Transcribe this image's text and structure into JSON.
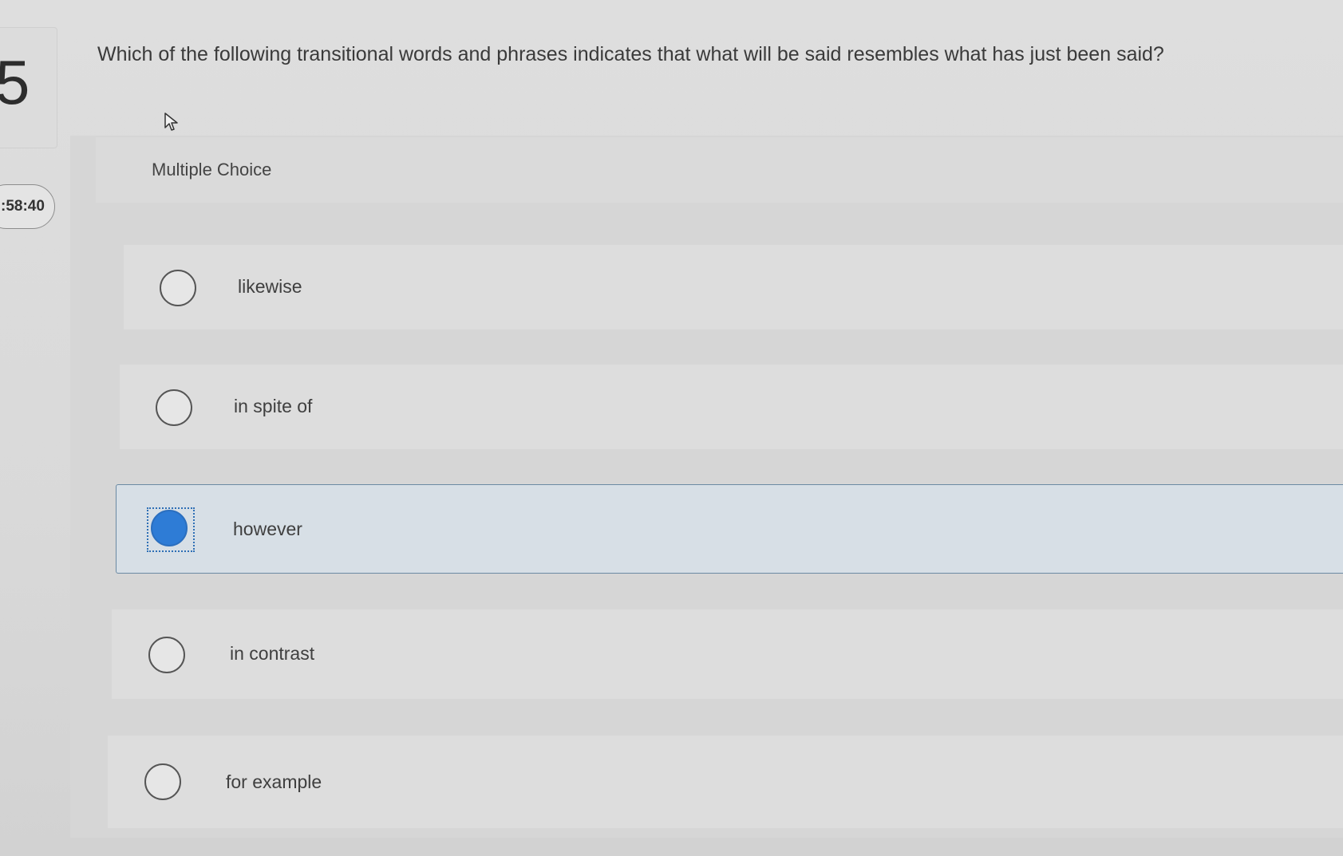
{
  "question_number": "5",
  "timer": ":58:40",
  "question": "Which of the following transitional words and phrases indicates that what will be said resembles what has just been said?",
  "type_label": "Multiple Choice",
  "options": [
    {
      "label": "likewise",
      "selected": false
    },
    {
      "label": "in spite of",
      "selected": false
    },
    {
      "label": "however",
      "selected": true
    },
    {
      "label": "in contrast",
      "selected": false
    },
    {
      "label": "for example",
      "selected": false
    }
  ],
  "colors": {
    "selected_radio": "#2e7cd6",
    "selected_row_bg": "#d7dfe6",
    "selected_row_border": "#6b8aa3"
  },
  "icons": {
    "cursor": "mouse-pointer-icon"
  }
}
